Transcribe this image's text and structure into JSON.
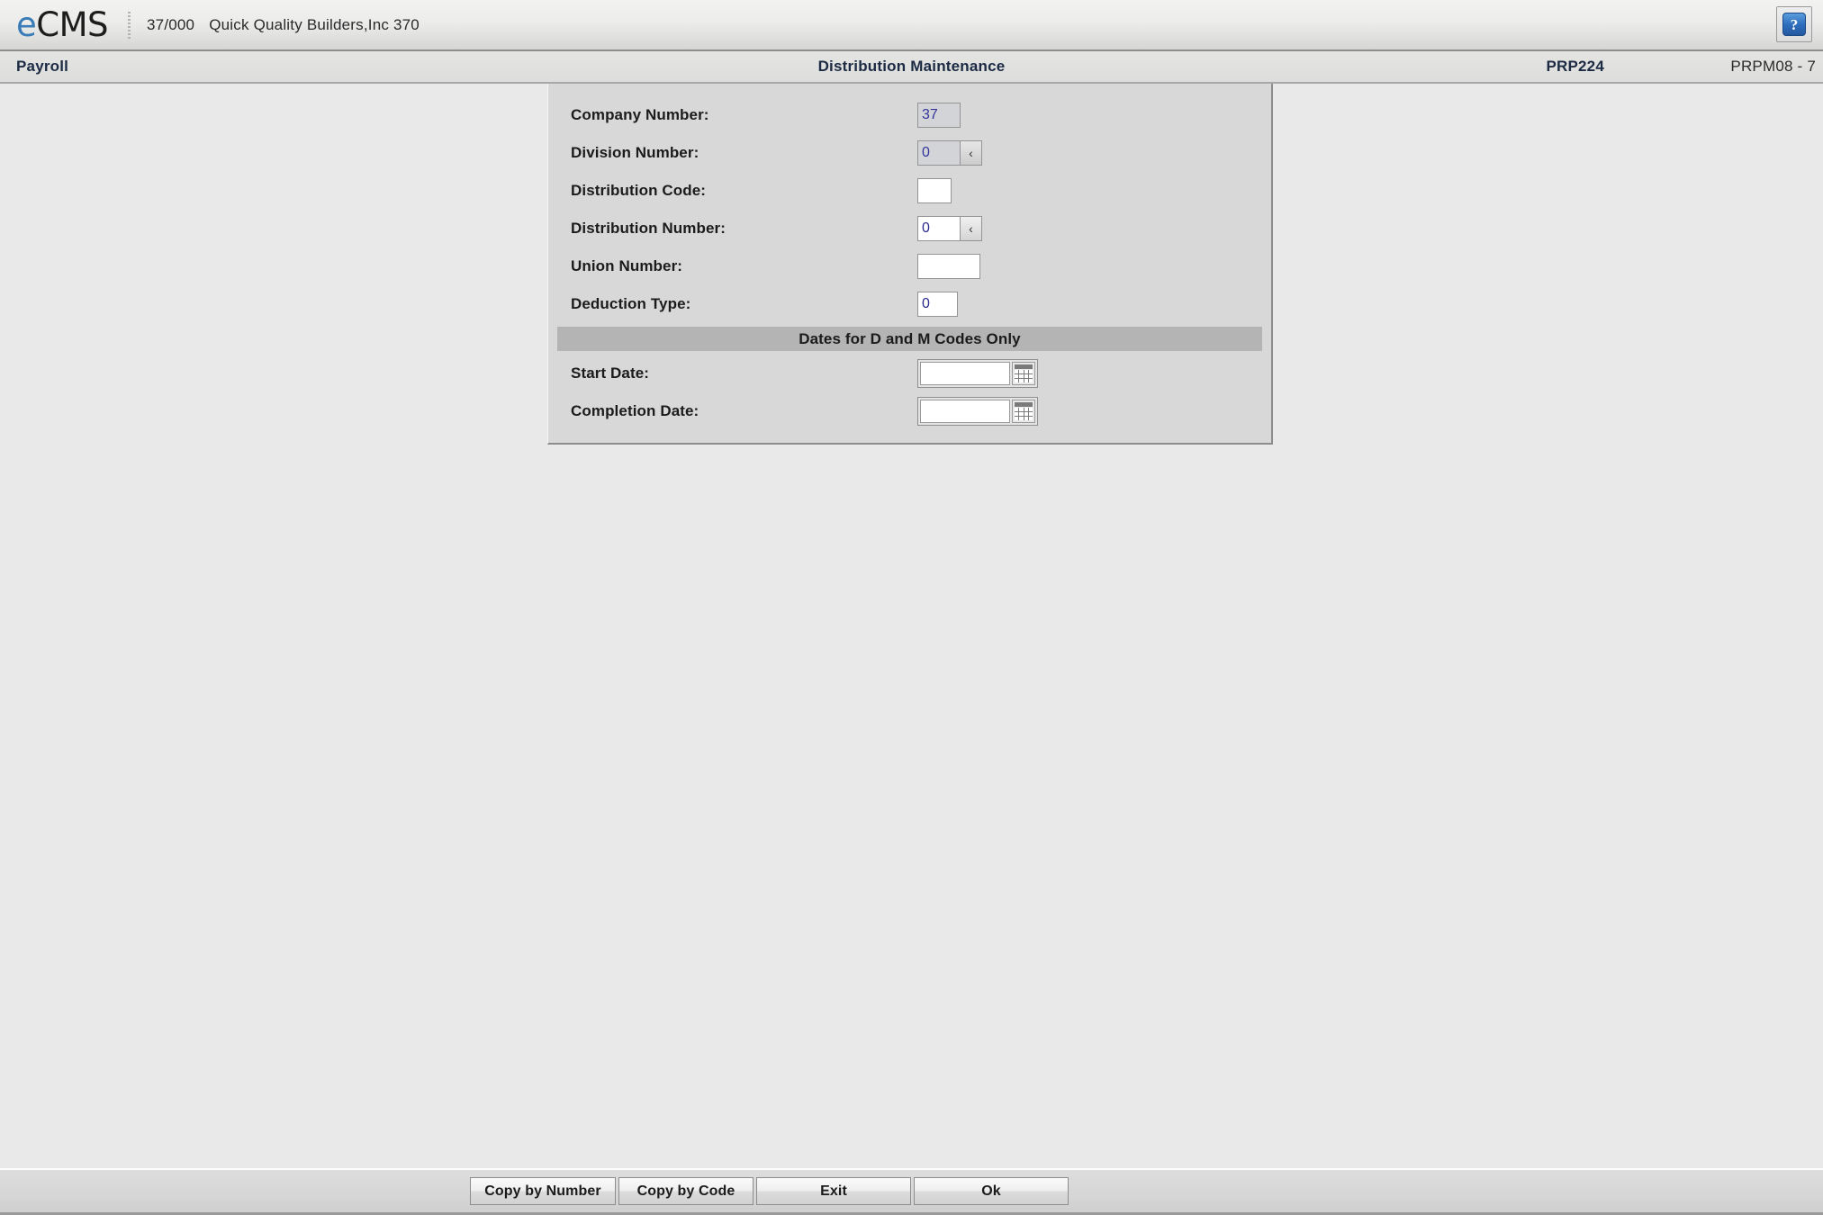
{
  "brand": {
    "logo_e": "e",
    "logo_cms": "CMS",
    "company_id": "37/000",
    "company_name": "Quick Quality Builders,Inc 370",
    "help_glyph": "?"
  },
  "subheader": {
    "module": "Payroll",
    "title": "Distribution Maintenance",
    "program_id": "PRP224",
    "screen_id": "PRPM08 - 7"
  },
  "form": {
    "fields": [
      {
        "label": "Company Number:",
        "value": "37",
        "readonly": true,
        "prompt": false
      },
      {
        "label": "Division Number:",
        "value": "0",
        "readonly": true,
        "prompt": true
      },
      {
        "label": "Distribution Code:",
        "value": "",
        "readonly": false,
        "prompt": false
      },
      {
        "label": "Distribution Number:",
        "value": "0",
        "readonly": false,
        "prompt": true
      },
      {
        "label": "Union Number:",
        "value": "",
        "readonly": false,
        "prompt": false
      },
      {
        "label": "Deduction Type:",
        "value": "0",
        "readonly": false,
        "prompt": false
      }
    ],
    "section_title": "Dates for D and M Codes Only",
    "date_fields": [
      {
        "label": "Start Date:",
        "value": ""
      },
      {
        "label": "Completion Date:",
        "value": ""
      }
    ],
    "prompt_glyph": "‹"
  },
  "footer": {
    "buttons": [
      {
        "label": "Copy by Number"
      },
      {
        "label": "Copy by Code"
      },
      {
        "label": "Exit"
      },
      {
        "label": "Ok"
      }
    ]
  },
  "colors": {
    "brand_blue": "#3a7cb8",
    "header_text": "#1c2a44",
    "panel_bg": "#d8d8d8",
    "section_bar": "#b4b4b4",
    "page_bg": "#e9e9e9",
    "field_text": "#2b2b8f",
    "readonly_bg": "#d3d4d8",
    "help_icon_blue": "#2f6fbe"
  }
}
